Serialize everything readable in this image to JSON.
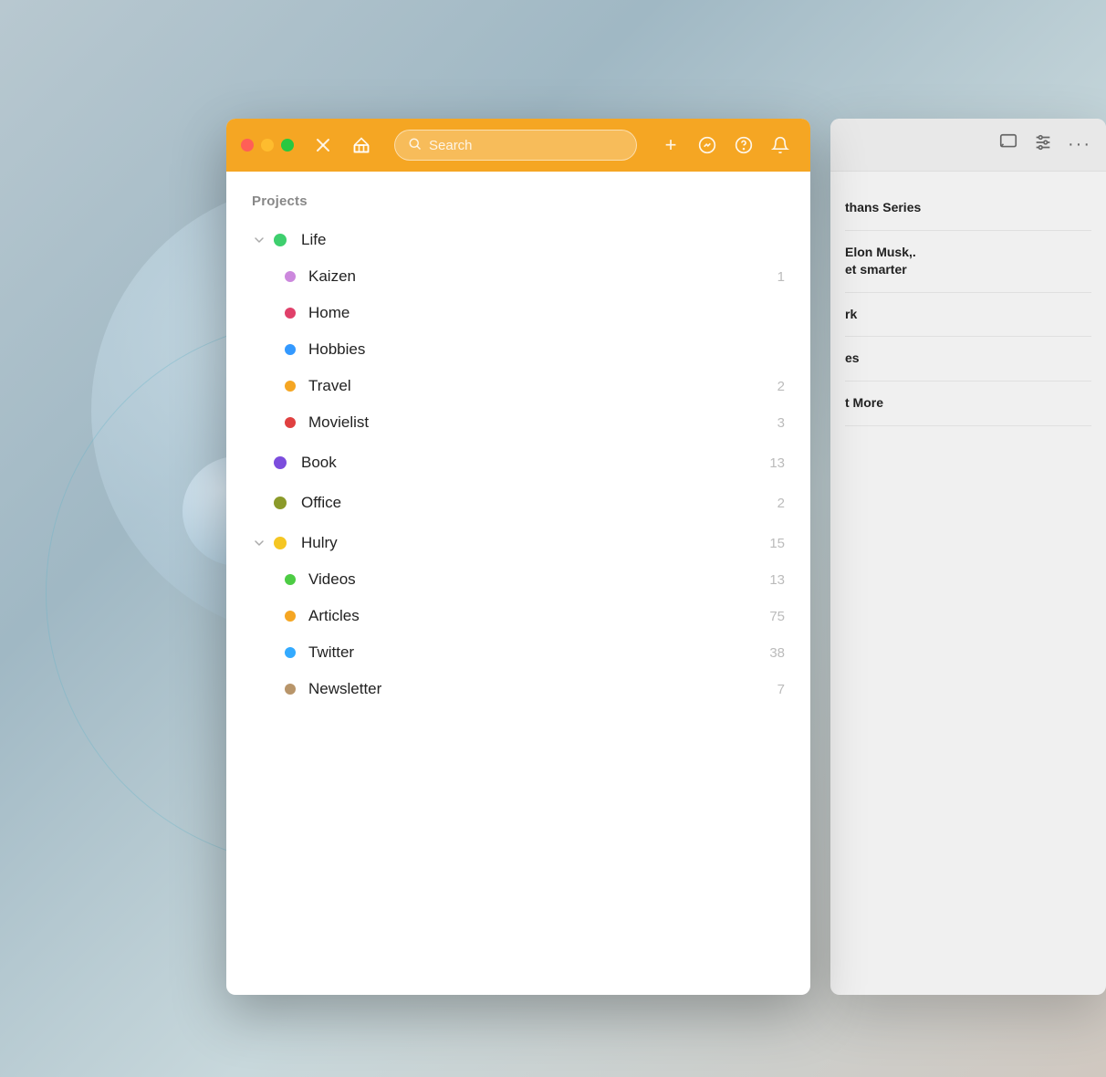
{
  "desktop": {
    "bg_color_start": "#b8c8d0",
    "bg_color_end": "#d0c8c0"
  },
  "titlebar": {
    "bg_color": "#f5a623",
    "traffic_lights": [
      {
        "color": "#ff5f57",
        "label": "close"
      },
      {
        "color": "#febc2e",
        "label": "minimize"
      },
      {
        "color": "#28c840",
        "label": "maximize"
      }
    ],
    "close_icon": "✕",
    "home_icon": "⌂",
    "search_placeholder": "Search",
    "add_icon": "+",
    "trending_icon": "↗",
    "help_icon": "?",
    "bell_icon": "🔔"
  },
  "projects": {
    "title": "Projects",
    "groups": [
      {
        "id": "life",
        "label": "Life",
        "dot_color": "#3ecf6e",
        "count": null,
        "expanded": true,
        "children": [
          {
            "label": "Kaizen",
            "dot_color": "#cc88dd",
            "count": "1"
          },
          {
            "label": "Home",
            "dot_color": "#e0406a",
            "count": null
          },
          {
            "label": "Hobbies",
            "dot_color": "#3399ff",
            "count": null
          },
          {
            "label": "Travel",
            "dot_color": "#f5a623",
            "count": "2"
          },
          {
            "label": "Movielist",
            "dot_color": "#e04040",
            "count": "3"
          }
        ]
      },
      {
        "id": "book",
        "label": "Book",
        "dot_color": "#7c4ddd",
        "count": "13",
        "expanded": false,
        "children": []
      },
      {
        "id": "office",
        "label": "Office",
        "dot_color": "#8b9a2a",
        "count": "2",
        "expanded": false,
        "children": []
      },
      {
        "id": "hulry",
        "label": "Hulry",
        "dot_color": "#f5c623",
        "count": "15",
        "expanded": true,
        "children": [
          {
            "label": "Videos",
            "dot_color": "#4dcc44",
            "count": "13"
          },
          {
            "label": "Articles",
            "dot_color": "#f5a623",
            "count": "75"
          },
          {
            "label": "Twitter",
            "dot_color": "#33aaff",
            "count": "38"
          },
          {
            "label": "Newsletter",
            "dot_color": "#b8956a",
            "count": "7"
          }
        ]
      }
    ]
  },
  "right_panel": {
    "toolbar_icons": [
      "comment",
      "sliders",
      "more"
    ],
    "items": [
      {
        "title": "thans Series",
        "subtitle": ""
      },
      {
        "title": "Elon Musk,. et smarter",
        "subtitle": ""
      },
      {
        "title": "rk",
        "subtitle": ""
      },
      {
        "title": "es",
        "subtitle": ""
      },
      {
        "title": "t More",
        "subtitle": ""
      }
    ]
  }
}
